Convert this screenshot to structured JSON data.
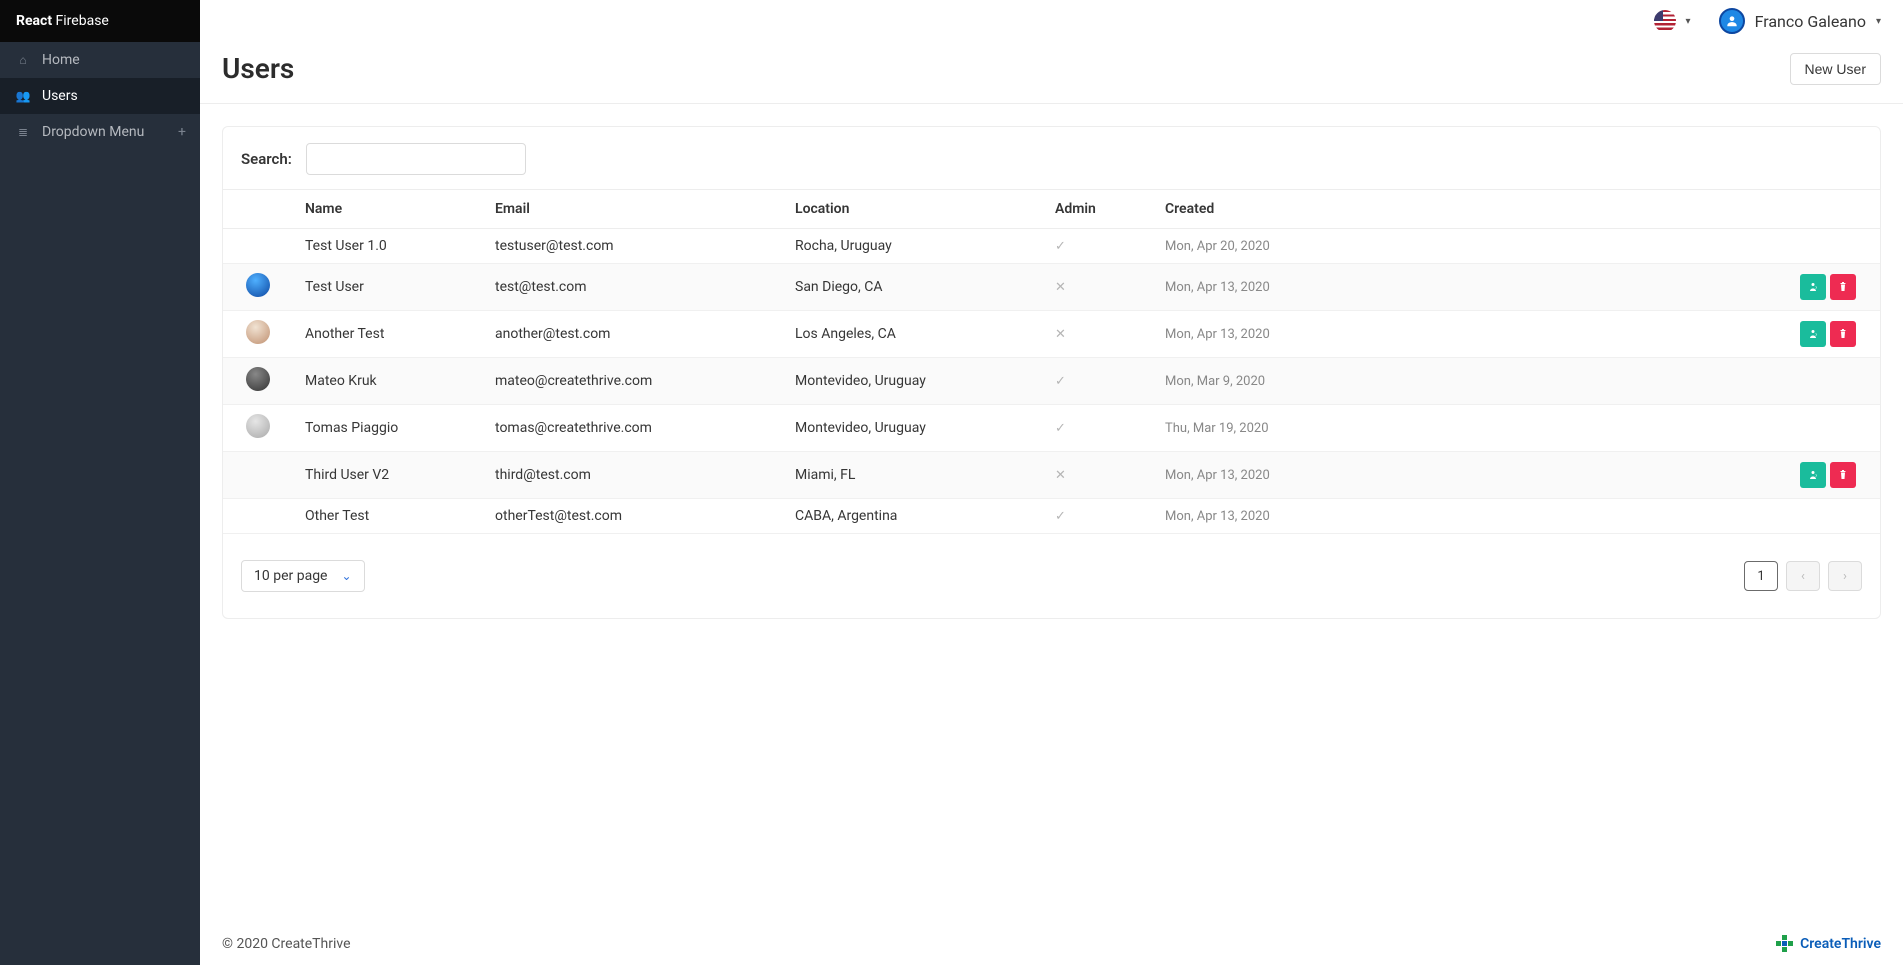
{
  "brand": {
    "bold": "React",
    "light": " Firebase"
  },
  "sidebar": {
    "items": [
      {
        "label": "Home",
        "active": false
      },
      {
        "label": "Users",
        "active": true
      },
      {
        "label": "Dropdown Menu",
        "active": false,
        "expandable": true
      }
    ]
  },
  "topbar": {
    "username": "Franco Galeano"
  },
  "page": {
    "title": "Users",
    "new_user_label": "New User"
  },
  "search": {
    "label": "Search:",
    "value": ""
  },
  "table": {
    "headers": {
      "name": "Name",
      "email": "Email",
      "location": "Location",
      "admin": "Admin",
      "created": "Created"
    },
    "rows": [
      {
        "avatar": "",
        "name": "Test User 1.0",
        "email": "testuser@test.com",
        "location": "Rocha, Uruguay",
        "admin": true,
        "created": "Mon, Apr 20, 2020",
        "editable": false
      },
      {
        "avatar": "av-blue",
        "name": "Test User",
        "email": "test@test.com",
        "location": "San Diego, CA",
        "admin": false,
        "created": "Mon, Apr 13, 2020",
        "editable": true
      },
      {
        "avatar": "av-light1",
        "name": "Another Test",
        "email": "another@test.com",
        "location": "Los Angeles, CA",
        "admin": false,
        "created": "Mon, Apr 13, 2020",
        "editable": true
      },
      {
        "avatar": "av-gray",
        "name": "Mateo Kruk",
        "email": "mateo@createthrive.com",
        "location": "Montevideo, Uruguay",
        "admin": true,
        "created": "Mon, Mar 9, 2020",
        "editable": false
      },
      {
        "avatar": "av-light2",
        "name": "Tomas Piaggio",
        "email": "tomas@createthrive.com",
        "location": "Montevideo, Uruguay",
        "admin": true,
        "created": "Thu, Mar 19, 2020",
        "editable": false
      },
      {
        "avatar": "av-light3",
        "name": "Third User V2",
        "email": "third@test.com",
        "location": "Miami, FL",
        "admin": false,
        "created": "Mon, Apr 13, 2020",
        "editable": true
      },
      {
        "avatar": "",
        "name": "Other Test",
        "email": "otherTest@test.com",
        "location": "CABA, Argentina",
        "admin": true,
        "created": "Mon, Apr 13, 2020",
        "editable": false
      }
    ]
  },
  "pagination": {
    "per_page_label": "10 per page",
    "current_page": "1"
  },
  "footer": {
    "copyright": "© 2020  CreateThrive",
    "logo_text": "CreateThrive"
  }
}
